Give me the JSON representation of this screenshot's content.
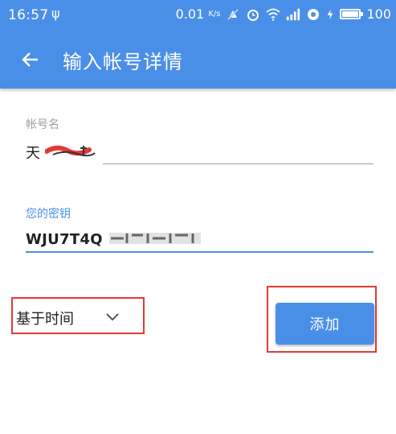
{
  "status_bar": {
    "time": "16:57",
    "usb_symbol": "ψ",
    "net_speed": "0.01",
    "net_speed_unit": "K/s",
    "battery": "100"
  },
  "app_bar": {
    "title": "输入帐号详情",
    "back_icon": "arrow-left-icon"
  },
  "form": {
    "account_label": "帐号名",
    "account_value": "天",
    "key_label": "您的密钥",
    "key_value": "WJU7T4Q"
  },
  "type_select": {
    "selected": "基于时间",
    "icon": "chevron-down-icon"
  },
  "add_button": {
    "label": "添加"
  },
  "colors": {
    "primary": "#4a8fe7",
    "highlight": "#e53935",
    "text": "#212121",
    "hint": "#9e9e9e"
  }
}
